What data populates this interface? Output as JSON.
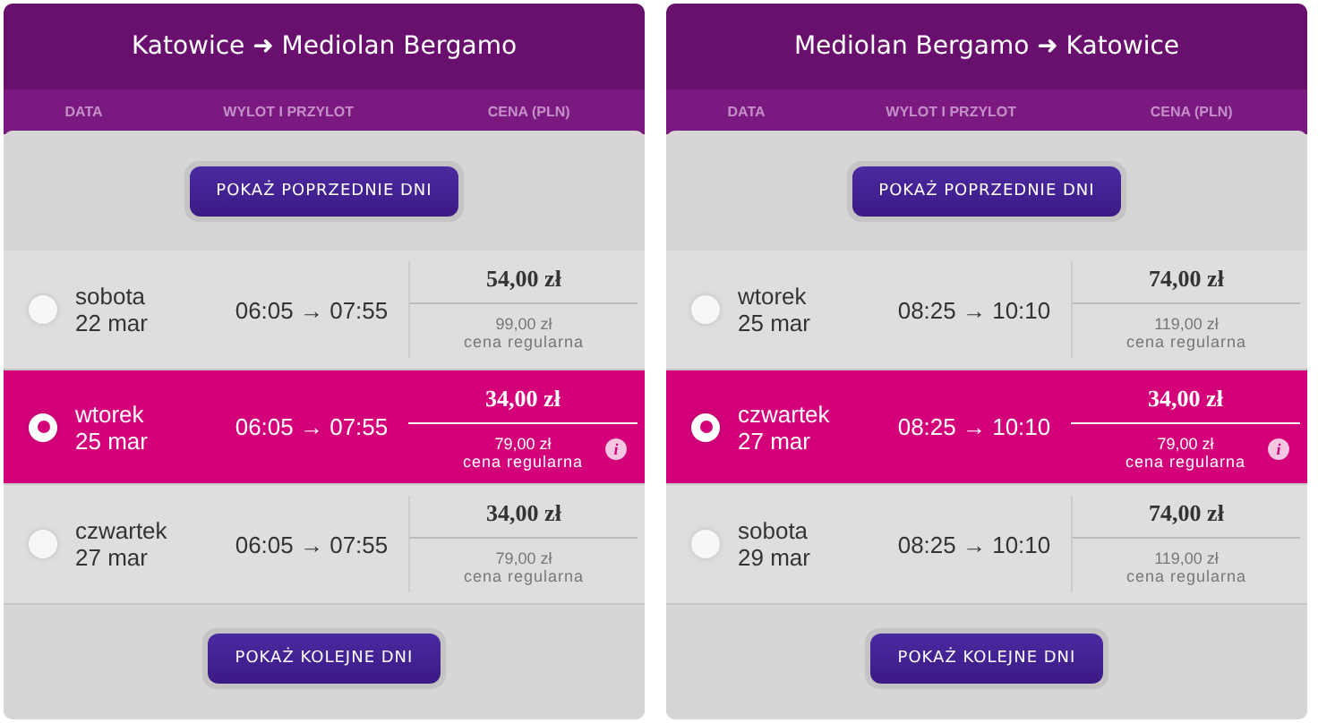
{
  "panels": [
    {
      "title": "Katowice ➜ Mediolan Bergamo",
      "columns": [
        "DATA",
        "WYLOT I PRZYLOT",
        "CENA (PLN)"
      ],
      "prev_button": "POKAŻ POPRZEDNIE DNI",
      "next_button": "POKAŻ KOLEJNE DNI",
      "rows": [
        {
          "day": "sobota",
          "date": "22 mar",
          "times": "06:05 → 07:55",
          "price": "54,00 zł",
          "regular_price": "99,00 zł",
          "regular_label": "cena regularna",
          "selected": false
        },
        {
          "day": "wtorek",
          "date": "25 mar",
          "times": "06:05 → 07:55",
          "price": "34,00 zł",
          "regular_price": "79,00 zł",
          "regular_label": "cena regularna",
          "selected": true,
          "info": "i"
        },
        {
          "day": "czwartek",
          "date": "27 mar",
          "times": "06:05 → 07:55",
          "price": "34,00 zł",
          "regular_price": "79,00 zł",
          "regular_label": "cena regularna",
          "selected": false
        }
      ]
    },
    {
      "title": "Mediolan Bergamo ➜ Katowice",
      "columns": [
        "DATA",
        "WYLOT I PRZYLOT",
        "CENA (PLN)"
      ],
      "prev_button": "POKAŻ POPRZEDNIE DNI",
      "next_button": "POKAŻ KOLEJNE DNI",
      "rows": [
        {
          "day": "wtorek",
          "date": "25 mar",
          "times": "08:25 → 10:10",
          "price": "74,00 zł",
          "regular_price": "119,00 zł",
          "regular_label": "cena regularna",
          "selected": false
        },
        {
          "day": "czwartek",
          "date": "27 mar",
          "times": "08:25 → 10:10",
          "price": "34,00 zł",
          "regular_price": "79,00 zł",
          "regular_label": "cena regularna",
          "selected": true,
          "info": "i"
        },
        {
          "day": "sobota",
          "date": "29 mar",
          "times": "08:25 → 10:10",
          "price": "74,00 zł",
          "regular_price": "119,00 zł",
          "regular_label": "cena regularna",
          "selected": false
        }
      ]
    }
  ]
}
